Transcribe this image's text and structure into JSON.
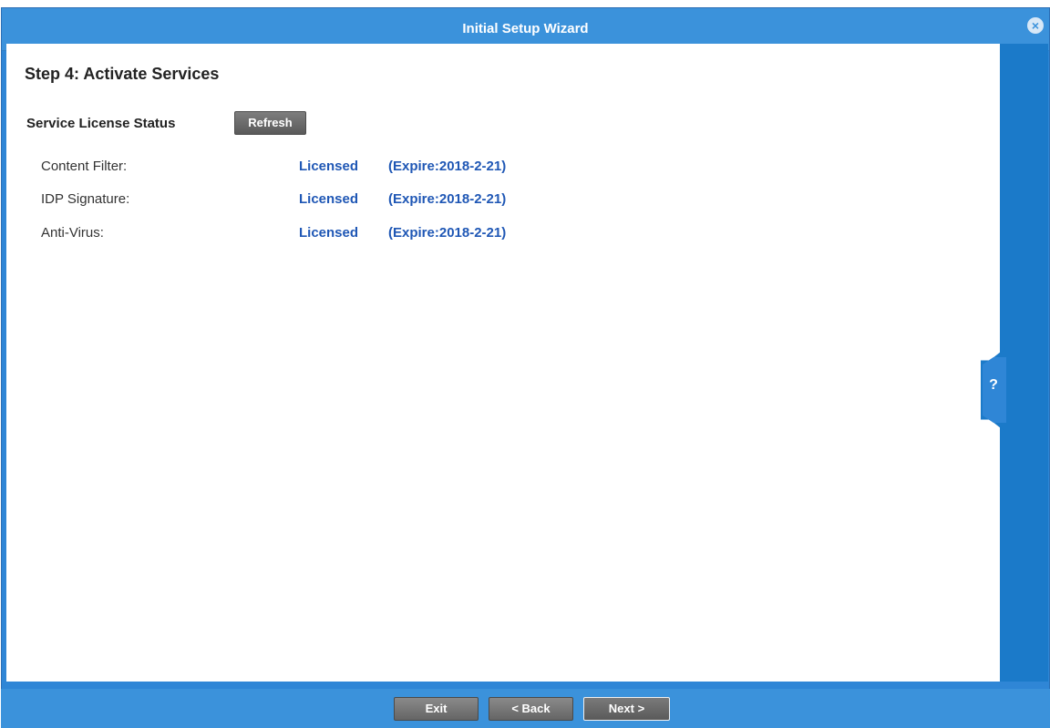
{
  "window": {
    "title": "Initial Setup Wizard",
    "close_icon": "close-icon"
  },
  "step": {
    "title": "Step 4: Activate Services"
  },
  "license": {
    "section_label": "Service License Status",
    "refresh_label": "Refresh",
    "services": [
      {
        "name": "Content Filter:",
        "status": "Licensed",
        "expire": "(Expire:2018-2-21)"
      },
      {
        "name": "IDP Signature:",
        "status": "Licensed",
        "expire": "(Expire:2018-2-21)"
      },
      {
        "name": "Anti-Virus:",
        "status": "Licensed",
        "expire": "(Expire:2018-2-21)"
      }
    ]
  },
  "help": {
    "label": "?",
    "icon": "help-icon"
  },
  "footer": {
    "exit_label": "Exit",
    "back_label": "< Back",
    "next_label": "Next >"
  },
  "colors": {
    "title_bar": "#3b92db",
    "right_rail": "#1b7ac9",
    "license_text": "#1f57b5"
  }
}
